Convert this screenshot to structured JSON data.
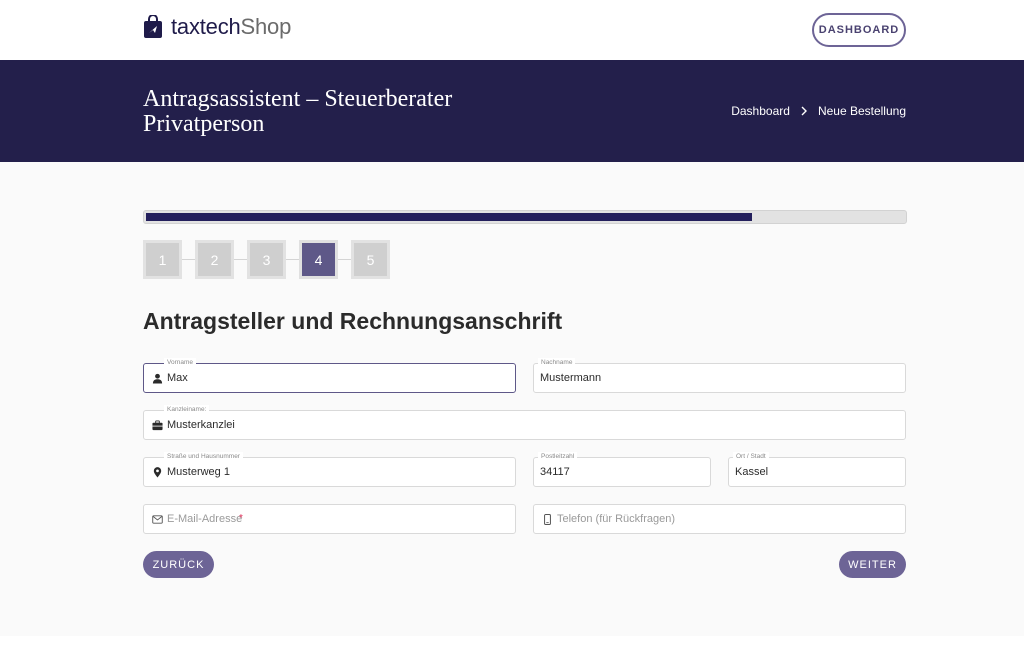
{
  "header": {
    "logo_main": "taxtech",
    "logo_suffix": "Shop",
    "dashboard_button": "DASHBOARD"
  },
  "hero": {
    "title_line1": "Antragsassistent – Steuerberater",
    "title_line2": "Privatperson",
    "breadcrumb": [
      "Dashboard",
      "Neue Bestellung"
    ]
  },
  "wizard": {
    "progress_percent": 80,
    "steps": [
      "1",
      "2",
      "3",
      "4",
      "5"
    ],
    "active_step": 4
  },
  "form": {
    "title": "Antragsteller und Rechnungsanschrift",
    "vorname": {
      "label": "Vorname",
      "value": "Max"
    },
    "nachname": {
      "label": "Nachname",
      "value": "Mustermann"
    },
    "kanzlei": {
      "label": "Kanzleiname:",
      "value": "Musterkanzlei"
    },
    "strasse": {
      "label": "Straße und Hausnummer",
      "value": "Musterweg 1"
    },
    "plz": {
      "label": "Postleitzahl",
      "value": "34117"
    },
    "ort": {
      "label": "Ort / Stadt",
      "value": "Kassel"
    },
    "email": {
      "placeholder": "E-Mail-Adresse",
      "required_mark": "*"
    },
    "telefon": {
      "placeholder": "Telefon (für Rückfragen)"
    },
    "back_button": "ZURÜCK",
    "next_button": "WEITER"
  },
  "colors": {
    "brand_dark": "#231f4b",
    "accent": "#6d6496",
    "required": "#e0305a"
  },
  "icons": {
    "logo": "shopping-bag-icon",
    "vorname": "user-icon",
    "kanzlei": "briefcase-icon",
    "strasse": "map-pin-icon",
    "email": "envelope-icon",
    "telefon": "mobile-phone-icon",
    "breadcrumb_separator": "chevron-right-icon"
  }
}
